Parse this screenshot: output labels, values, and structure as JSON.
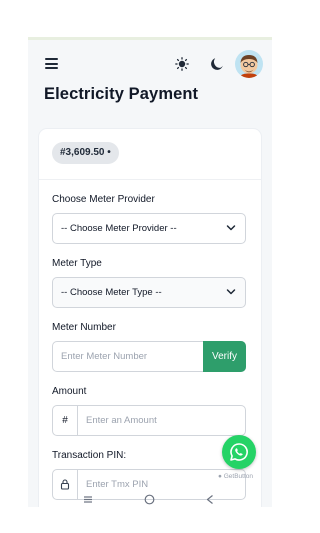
{
  "header": {
    "menu_icon": "hamburger-menu-icon",
    "light_mode_icon": "sun-icon",
    "dark_mode_icon": "moon-icon",
    "avatar_icon": "user-avatar-icon"
  },
  "page": {
    "title": "Electricity Payment"
  },
  "wallet": {
    "balance": "#3,609.50 •"
  },
  "form": {
    "meter_provider": {
      "label": "Choose Meter Provider",
      "value": "-- Choose Meter Provider --"
    },
    "meter_type": {
      "label": "Meter Type",
      "value": "-- Choose Meter Type --"
    },
    "meter_number": {
      "label": "Meter Number",
      "placeholder": "Enter Meter Number",
      "verify_label": "Verify"
    },
    "amount": {
      "label": "Amount",
      "prefix": "#",
      "placeholder": "Enter an Amount"
    },
    "pin": {
      "label": "Transaction PIN:",
      "placeholder": "Enter Tmx PIN"
    }
  },
  "floating": {
    "whatsapp_icon": "whatsapp-icon",
    "credit": "GetButton"
  },
  "colors": {
    "accent": "#2e9e6b",
    "whatsapp": "#25d366"
  }
}
